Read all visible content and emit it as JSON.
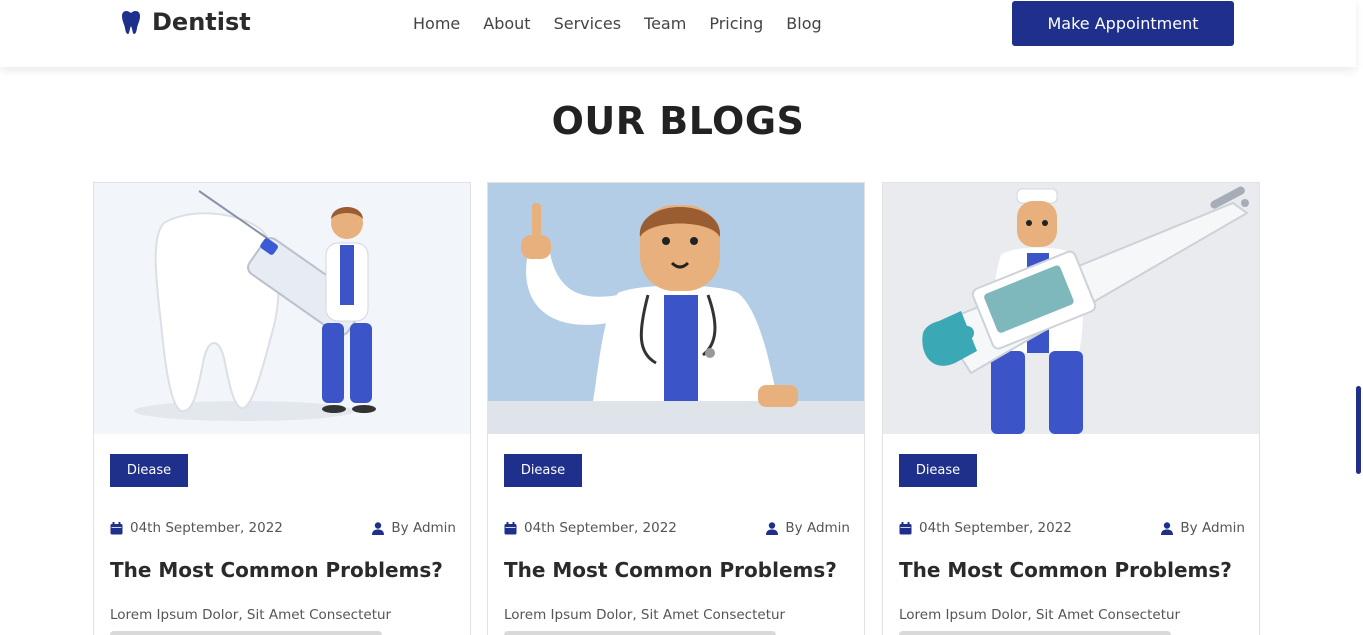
{
  "header": {
    "brand": "Dentist",
    "nav": [
      "Home",
      "About",
      "Services",
      "Team",
      "Pricing",
      "Blog"
    ],
    "cta": "Make Appointment"
  },
  "section": {
    "title": "OUR BLOGS"
  },
  "cards": [
    {
      "tag": "Diease",
      "date": "04th September, 2022",
      "author": "By Admin",
      "title": "The Most Common Problems?",
      "excerpt": "Lorem Ipsum Dolor, Sit Amet Consectetur",
      "image": "doctor-with-tooth-and-syringe"
    },
    {
      "tag": "Diease",
      "date": "04th September, 2022",
      "author": "By Admin",
      "title": "The Most Common Problems?",
      "excerpt": "Lorem Ipsum Dolor, Sit Amet Consectetur",
      "image": "doctor-pointing-up"
    },
    {
      "tag": "Diease",
      "date": "04th September, 2022",
      "author": "By Admin",
      "title": "The Most Common Problems?",
      "excerpt": "Lorem Ipsum Dolor, Sit Amet Consectetur",
      "image": "doctor-with-thermometer"
    }
  ],
  "colors": {
    "primary": "#1f2f8c",
    "heading": "#222222",
    "text": "#555555"
  }
}
